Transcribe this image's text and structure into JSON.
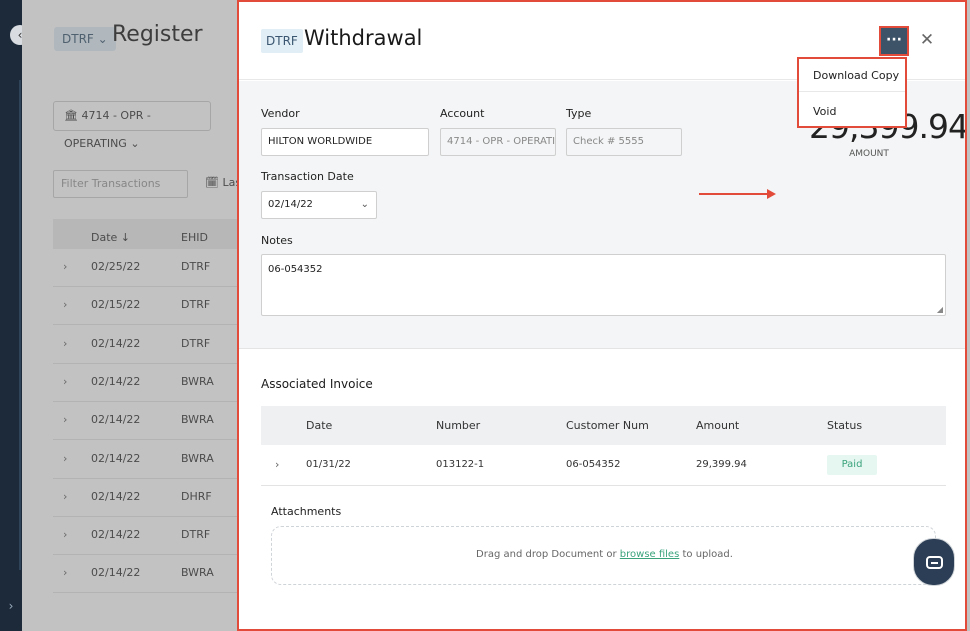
{
  "register": {
    "badge": "DTRF ⌄",
    "title": "Register",
    "account_select": "🏛 4714 - OPR - OPERATING ⌄",
    "filter_placeholder": "Filter Transactions",
    "last_label": "🗓 Last",
    "columns": [
      "Date ↓",
      "EHID"
    ],
    "rows": [
      {
        "date": "02/25/22",
        "ehid": "DTRF"
      },
      {
        "date": "02/15/22",
        "ehid": "DTRF"
      },
      {
        "date": "02/14/22",
        "ehid": "DTRF"
      },
      {
        "date": "02/14/22",
        "ehid": "BWRA"
      },
      {
        "date": "02/14/22",
        "ehid": "BWRA"
      },
      {
        "date": "02/14/22",
        "ehid": "BWRA"
      },
      {
        "date": "02/14/22",
        "ehid": "DHRF"
      },
      {
        "date": "02/14/22",
        "ehid": "DTRF"
      },
      {
        "date": "02/14/22",
        "ehid": "BWRA"
      }
    ]
  },
  "modal": {
    "badge": "DTRF",
    "title": "Withdrawal",
    "more_label": "···",
    "close_label": "✕",
    "menu": {
      "download_copy": "Download Copy",
      "void": "Void"
    },
    "form": {
      "vendor_label": "Vendor",
      "vendor_value": "HILTON WORLDWIDE",
      "account_label": "Account",
      "account_value": "4714 - OPR - OPERATI...",
      "type_label": "Type",
      "type_value": "Check # 5555",
      "amount_value": "29,399.94",
      "amount_label": "AMOUNT",
      "transaction_date_label": "Transaction Date",
      "transaction_date_value": "02/14/22",
      "notes_label": "Notes",
      "notes_value": "06-054352"
    },
    "invoice": {
      "section_title": "Associated Invoice",
      "columns": [
        "Date",
        "Number",
        "Customer Num",
        "Amount",
        "Status"
      ],
      "rows": [
        {
          "date": "01/31/22",
          "number": "013122-1",
          "customer_num": "06-054352",
          "amount": "29,399.94",
          "status": "Paid"
        }
      ]
    },
    "attachments": {
      "label": "Attachments",
      "dz_before": "Drag and drop Document or ",
      "dz_link": "browse files",
      "dz_after": " to upload."
    }
  },
  "colors": {
    "highlight": "#e24b3a",
    "accent_green": "#3aa37c",
    "nav_dark": "#1c2a3a"
  }
}
